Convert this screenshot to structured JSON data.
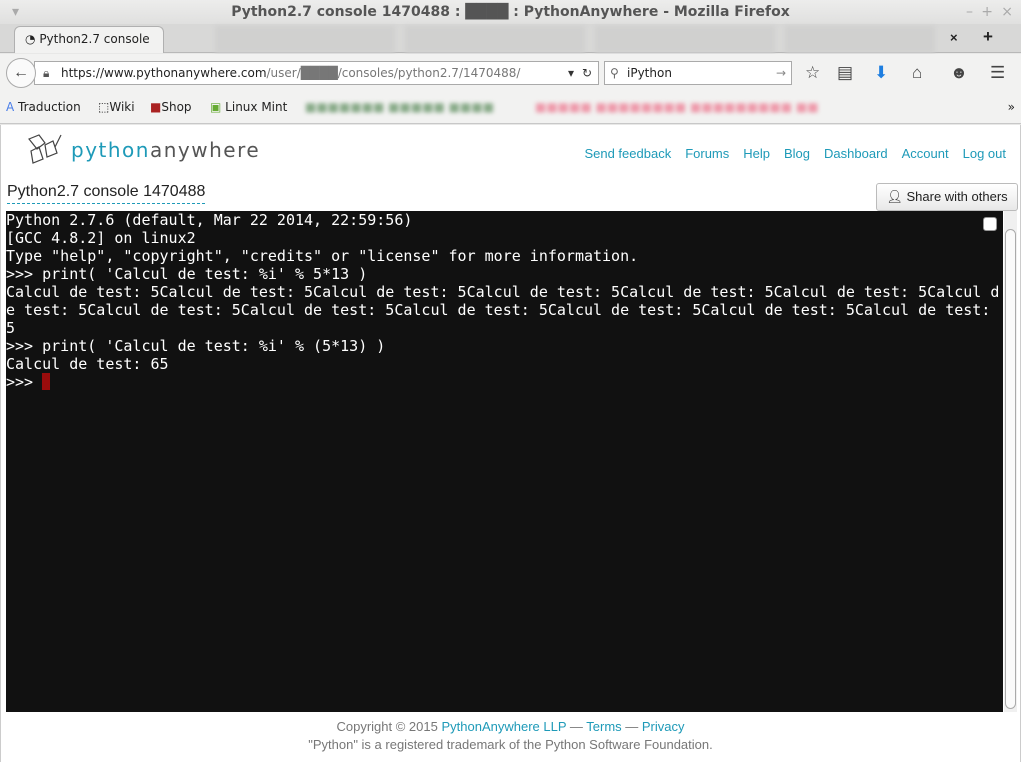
{
  "window": {
    "title": "Python2.7 console 1470488 : ████ : PythonAnywhere - Mozilla Firefox"
  },
  "tabs": {
    "active_label": "Python2.7 console ...",
    "close": "×",
    "new_tab": "+"
  },
  "navbar": {
    "url_domain": "https://www.pythonanywhere.com",
    "url_path": "/user/████/consoles/python2.7/1470488/",
    "search_value": "iPython"
  },
  "bookmarks": [
    {
      "label": "Traduction"
    },
    {
      "label": "Wiki"
    },
    {
      "label": "Shop"
    },
    {
      "label": "Linux Mint"
    }
  ],
  "site": {
    "logo": "pythonanywhere",
    "nav": [
      "Send feedback",
      "Forums",
      "Help",
      "Blog",
      "Dashboard",
      "Account",
      "Log out"
    ],
    "console_title": "Python2.7 console 1470488",
    "share_label": "Share with others"
  },
  "console": {
    "text": "Python 2.7.6 (default, Mar 22 2014, 22:59:56)\n[GCC 4.8.2] on linux2\nType \"help\", \"copyright\", \"credits\" or \"license\" for more information.\n>>> print( 'Calcul de test: %i' % 5*13 )\nCalcul de test: 5Calcul de test: 5Calcul de test: 5Calcul de test: 5Calcul de test: 5Calcul de test: 5Calcul de test: 5Calcul de test: 5Calcul de test: 5Calcul de test: 5Calcul de test: 5Calcul de test: 5Calcul de test: 5\n>>> print( 'Calcul de test: %i' % (5*13) )\nCalcul de test: 65\n",
    "prompt": ">>> "
  },
  "footer": {
    "copyright": "Copyright © 2015 ",
    "company": "PythonAnywhere LLP",
    "sep": " — ",
    "terms": "Terms",
    "privacy": "Privacy",
    "trademark": "\"Python\" is a registered trademark of the Python Software Foundation."
  }
}
